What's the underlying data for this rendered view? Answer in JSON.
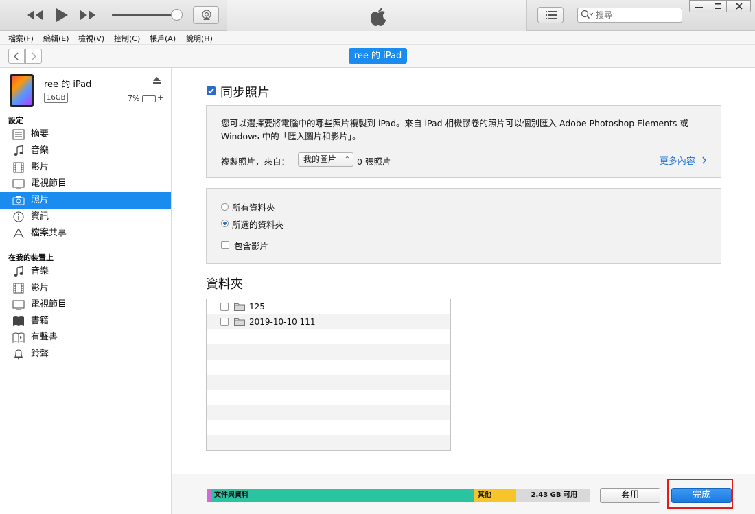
{
  "window": {
    "search_placeholder": "搜尋"
  },
  "menu": [
    "檔案(F)",
    "編輯(E)",
    "檢視(V)",
    "控制(C)",
    "帳戶(A)",
    "說明(H)"
  ],
  "navbar": {
    "device_pill": "ree 的 iPad"
  },
  "device": {
    "name": "ree 的 iPad",
    "capacity": "16GB",
    "battery_percent": "7%",
    "battery_level": 0.07
  },
  "sidebar": {
    "settings_header": "設定",
    "settings_items": [
      {
        "label": "摘要",
        "icon": "summary-icon"
      },
      {
        "label": "音樂",
        "icon": "music-note-icon"
      },
      {
        "label": "影片",
        "icon": "film-icon"
      },
      {
        "label": "電視節目",
        "icon": "tv-icon"
      },
      {
        "label": "照片",
        "icon": "camera-icon"
      },
      {
        "label": "資訊",
        "icon": "info-icon"
      },
      {
        "label": "檔案共享",
        "icon": "file-sharing-icon"
      }
    ],
    "active_item": "照片",
    "ondevice_header": "在我的裝置上",
    "ondevice_items": [
      {
        "label": "音樂",
        "icon": "music-note-icon"
      },
      {
        "label": "影片",
        "icon": "film-icon"
      },
      {
        "label": "電視節目",
        "icon": "tv-icon"
      },
      {
        "label": "書籍",
        "icon": "book-icon"
      },
      {
        "label": "有聲書",
        "icon": "audiobook-icon"
      },
      {
        "label": "鈴聲",
        "icon": "bell-icon"
      }
    ]
  },
  "main": {
    "sync_title": "同步照片",
    "sync_checked": true,
    "description": "您可以選擇要將電腦中的哪些照片複製到 iPad。來自 iPad 相機膠卷的照片可以個別匯入 Adobe Photoshop Elements 或 Windows 中的「匯入圖片和影片」。",
    "copy_from_label": "複製照片，來自：",
    "copy_from_value": "我的圖片",
    "photo_count": "0 張照片",
    "more_link": "更多內容",
    "options": {
      "all_folders": "所有資料夾",
      "selected_folders": "所選的資料夾",
      "selected": "selected_folders",
      "include_videos": "包含影片",
      "include_videos_checked": false
    },
    "folders_title": "資料夾",
    "folders": [
      {
        "name": "125",
        "checked": false
      },
      {
        "name": "2019-10-10 111",
        "checked": false
      }
    ]
  },
  "storage": {
    "segments": [
      {
        "label": "",
        "color": "#d36ad6",
        "fraction": 0.008
      },
      {
        "label": "文件與資料",
        "color": "#2bc3a0",
        "fraction": 0.69
      },
      {
        "label": "其他",
        "color": "#f7c52a",
        "fraction": 0.11
      },
      {
        "label": "2.43 GB 可用",
        "color": "#d9d9d9",
        "fraction": 0.192
      }
    ]
  },
  "buttons": {
    "apply": "套用",
    "done": "完成"
  },
  "colors": {
    "accent": "#1a8cf0",
    "highlight": "#e21b1b"
  }
}
